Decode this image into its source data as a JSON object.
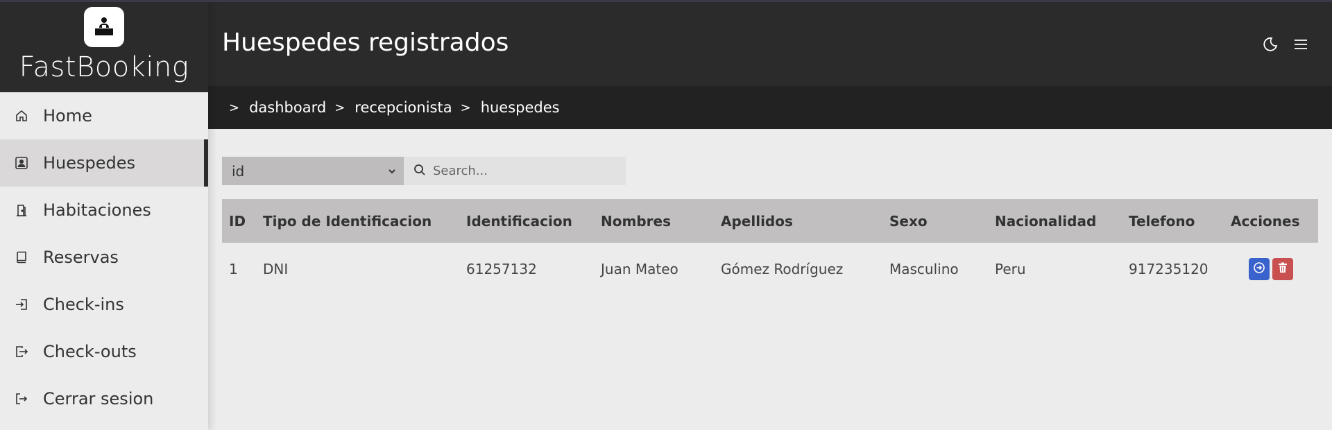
{
  "app": {
    "brand": "FastBooking"
  },
  "sidebar": {
    "items": [
      {
        "label": "Home",
        "icon": "home-icon",
        "active": false
      },
      {
        "label": "Huespedes",
        "icon": "person-badge-icon",
        "active": true
      },
      {
        "label": "Habitaciones",
        "icon": "door-icon",
        "active": false
      },
      {
        "label": "Reservas",
        "icon": "book-icon",
        "active": false
      },
      {
        "label": "Check-ins",
        "icon": "box-arrow-in-icon",
        "active": false
      },
      {
        "label": "Check-outs",
        "icon": "box-arrow-out-icon",
        "active": false
      },
      {
        "label": "Cerrar sesion",
        "icon": "logout-icon",
        "active": false
      }
    ]
  },
  "header": {
    "title": "Huespedes registrados",
    "icons": [
      "moon-icon",
      "menu-icon"
    ]
  },
  "breadcrumb": [
    "dashboard",
    "recepcionista",
    "huespedes"
  ],
  "filters": {
    "select_value": "id",
    "search_placeholder": "Search..."
  },
  "table": {
    "columns": [
      "ID",
      "Tipo de Identificacion",
      "Identificacion",
      "Nombres",
      "Apellidos",
      "Sexo",
      "Nacionalidad",
      "Telefono",
      "Acciones"
    ],
    "rows": [
      {
        "id": "1",
        "tipo": "DNI",
        "identificacion": "61257132",
        "nombres": "Juan Mateo",
        "apellidos": "Gómez Rodríguez",
        "sexo": "Masculino",
        "nacionalidad": "Peru",
        "telefono": "917235120"
      }
    ]
  },
  "colors": {
    "header_bg": "#2b2b2b",
    "breadcrumb_bg": "#222222",
    "sidebar_bg": "#ececec",
    "active_item_bg": "#dad8d8",
    "table_head_bg": "#c1bfbf",
    "view_button": "#3a62cc",
    "delete_button": "#c85050"
  }
}
